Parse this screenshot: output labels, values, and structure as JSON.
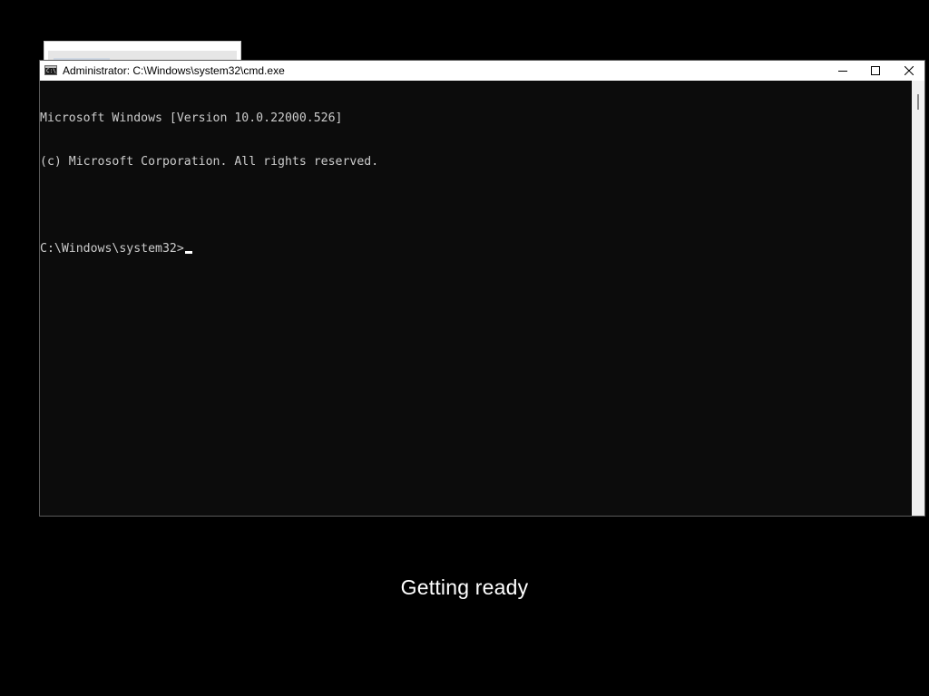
{
  "background_window": {},
  "console_window": {
    "title": "Administrator: C:\\Windows\\system32\\cmd.exe",
    "icon": "cmd-icon",
    "controls": {
      "minimize_icon": "minimize-icon",
      "maximize_icon": "maximize-icon",
      "close_icon": "close-icon"
    },
    "lines": [
      "Microsoft Windows [Version 10.0.22000.526]",
      "(c) Microsoft Corporation. All rights reserved.",
      ""
    ],
    "prompt": "C:\\Windows\\system32>"
  },
  "status": {
    "text": "Getting ready"
  },
  "colors": {
    "background": "#000000",
    "console_background": "#0c0c0c",
    "console_text": "#cccccc",
    "title_bar": "#ffffff",
    "status_text": "#ffffff"
  }
}
